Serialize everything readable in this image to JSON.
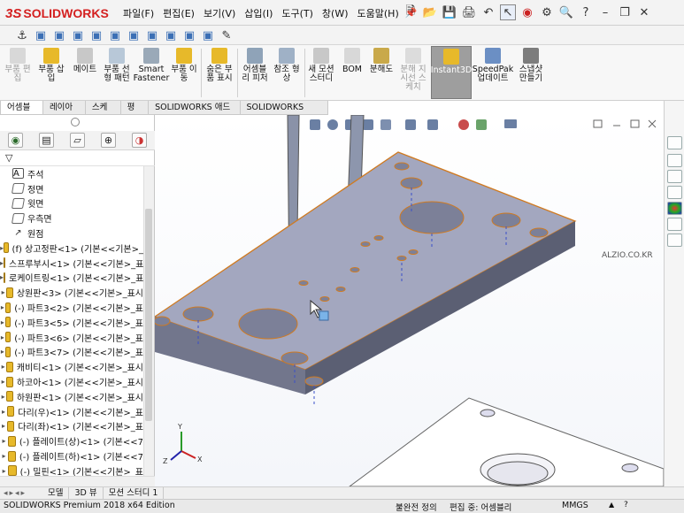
{
  "app": {
    "logo_ds": "3S",
    "logo_text": "SOLIDWORKS",
    "watermark": "ALZIO.CO.KR"
  },
  "menu": [
    "파일(F)",
    "편집(E)",
    "보기(V)",
    "삽입(I)",
    "도구(T)",
    "창(W)",
    "도움말(H)"
  ],
  "ribbon": [
    {
      "label": "부품 편\n집",
      "disabled": true
    },
    {
      "label": "부품 삽\n입",
      "disabled": false
    },
    {
      "label": "메이트",
      "disabled": false
    },
    {
      "label": "부품 선\n형 패턴",
      "disabled": false
    },
    {
      "label": "Smart\nFastener",
      "disabled": false
    },
    {
      "label": "부품 이\n동",
      "disabled": false
    },
    {
      "label": "숨은 부\n품 표시",
      "disabled": false
    },
    {
      "label": "어셈블\n리 피처",
      "disabled": false
    },
    {
      "label": "참조 형\n상",
      "disabled": false
    },
    {
      "label": "새 모션\n스터디",
      "disabled": false
    },
    {
      "label": "BOM",
      "disabled": false
    },
    {
      "label": "분해도",
      "disabled": false
    },
    {
      "label": "분해 지\n시선 스\n케치",
      "disabled": true
    },
    {
      "label": "Instant3D",
      "disabled": false,
      "active": true
    },
    {
      "label": "SpeedPak\n업데이트",
      "disabled": false
    },
    {
      "label": "스냅샷\n만들기",
      "disabled": false
    }
  ],
  "tabs": [
    "어셈블리",
    "레이아웃",
    "스케치",
    "평가",
    "SOLIDWORKS 애드인",
    "SOLIDWORKS MBD"
  ],
  "tree": [
    {
      "label": "주석",
      "icon": "annotation",
      "expand": false
    },
    {
      "label": "정면",
      "icon": "plane",
      "expand": false
    },
    {
      "label": "윗면",
      "icon": "plane",
      "expand": false
    },
    {
      "label": "우측면",
      "icon": "plane",
      "expand": false
    },
    {
      "label": "원점",
      "icon": "origin",
      "expand": false
    },
    {
      "label": "(f) 상고정판<1> (기본<<기본>_",
      "icon": "part",
      "expand": true
    },
    {
      "label": "스프루부시<1> (기본<<기본>_표",
      "icon": "part",
      "expand": true
    },
    {
      "label": "로케이트링<1> (기본<<기본>_표",
      "icon": "part",
      "expand": true
    },
    {
      "label": "상원판<3> (기본<<기본>_표시",
      "icon": "part",
      "expand": true
    },
    {
      "label": "(-) 파트3<2> (기본<<기본>_표",
      "icon": "part",
      "expand": true
    },
    {
      "label": "(-) 파트3<5> (기본<<기본>_표",
      "icon": "part",
      "expand": true
    },
    {
      "label": "(-) 파트3<6> (기본<<기본>_표",
      "icon": "part",
      "expand": true
    },
    {
      "label": "(-) 파트3<7> (기본<<기본>_표",
      "icon": "part",
      "expand": true
    },
    {
      "label": "캐비티<1> (기본<<기본>_표시",
      "icon": "part",
      "expand": true
    },
    {
      "label": "하코아<1> (기본<<기본>_표시",
      "icon": "part",
      "expand": true
    },
    {
      "label": "하원판<1> (기본<<기본>_표시",
      "icon": "part",
      "expand": true
    },
    {
      "label": "다리(우)<1> (기본<<기본>_표",
      "icon": "part",
      "expand": true
    },
    {
      "label": "다리(좌)<1> (기본<<기본>_표",
      "icon": "part",
      "expand": true
    },
    {
      "label": "(-) 플레이트(상)<1> (기본<<7",
      "icon": "part",
      "expand": true
    },
    {
      "label": "(-) 플레이트(하)<1> (기본<<7",
      "icon": "part",
      "expand": true
    },
    {
      "label": "(-) 밀핀<1> (기본<<기본>_표",
      "icon": "part",
      "expand": true
    }
  ],
  "bottom_tabs": [
    "모델",
    "3D 뷰",
    "모션 스터디 1"
  ],
  "status": {
    "edition": "SOLIDWORKS Premium 2018 x64 Edition",
    "definition": "불완전 정의",
    "editing": "편집 중: 어셈블리",
    "units": "MMGS"
  }
}
